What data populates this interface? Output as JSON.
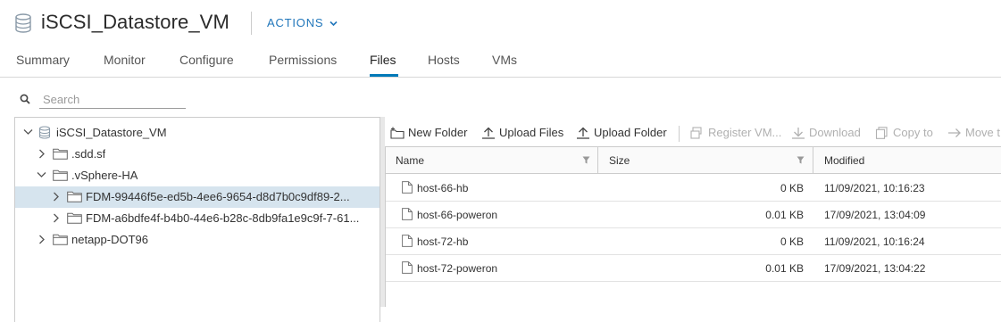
{
  "header": {
    "title": "iSCSI_Datastore_VM",
    "title_icon": "datastore-icon",
    "actions_label": "ACTIONS"
  },
  "tabs": [
    {
      "label": "Summary",
      "active": false
    },
    {
      "label": "Monitor",
      "active": false
    },
    {
      "label": "Configure",
      "active": false
    },
    {
      "label": "Permissions",
      "active": false
    },
    {
      "label": "Files",
      "active": true
    },
    {
      "label": "Hosts",
      "active": false
    },
    {
      "label": "VMs",
      "active": false
    }
  ],
  "search": {
    "placeholder": "Search",
    "value": ""
  },
  "tree": [
    {
      "label": "iSCSI_Datastore_VM",
      "icon": "datastore-icon",
      "expanded": true,
      "selected": false
    },
    {
      "label": ".sdd.sf",
      "icon": "folder-icon",
      "expanded": false,
      "selected": false
    },
    {
      "label": ".vSphere-HA",
      "icon": "folder-icon",
      "expanded": true,
      "selected": false
    },
    {
      "label": "FDM-99446f5e-ed5b-4ee6-9654-d8d7b0c9df89-2...",
      "icon": "folder-icon",
      "expanded": false,
      "selected": true
    },
    {
      "label": "FDM-a6bdfe4f-b4b0-44e6-b28c-8db9fa1e9c9f-7-61...",
      "icon": "folder-icon",
      "expanded": false,
      "selected": false
    },
    {
      "label": "netapp-DOT96",
      "icon": "folder-icon",
      "expanded": false,
      "selected": false
    }
  ],
  "toolbar": {
    "new_folder": "New Folder",
    "upload_files": "Upload Files",
    "upload_folder": "Upload Folder",
    "register_vm": "Register VM...",
    "download": "Download",
    "copy_to": "Copy to",
    "move_to": "Move t"
  },
  "grid": {
    "columns": [
      "Name",
      "Size",
      "Modified"
    ],
    "rows": [
      {
        "name": "host-66-hb",
        "size": "0 KB",
        "modified": "11/09/2021, 10:16:23"
      },
      {
        "name": "host-66-poweron",
        "size": "0.01 KB",
        "modified": "17/09/2021, 13:04:09"
      },
      {
        "name": "host-72-hb",
        "size": "0 KB",
        "modified": "11/09/2021, 10:16:24"
      },
      {
        "name": "host-72-poweron",
        "size": "0.01 KB",
        "modified": "17/09/2021, 13:04:22"
      }
    ]
  },
  "colors": {
    "accent": "#0079b8",
    "link": "#2277bb",
    "selected_row": "#d6e4ee"
  }
}
